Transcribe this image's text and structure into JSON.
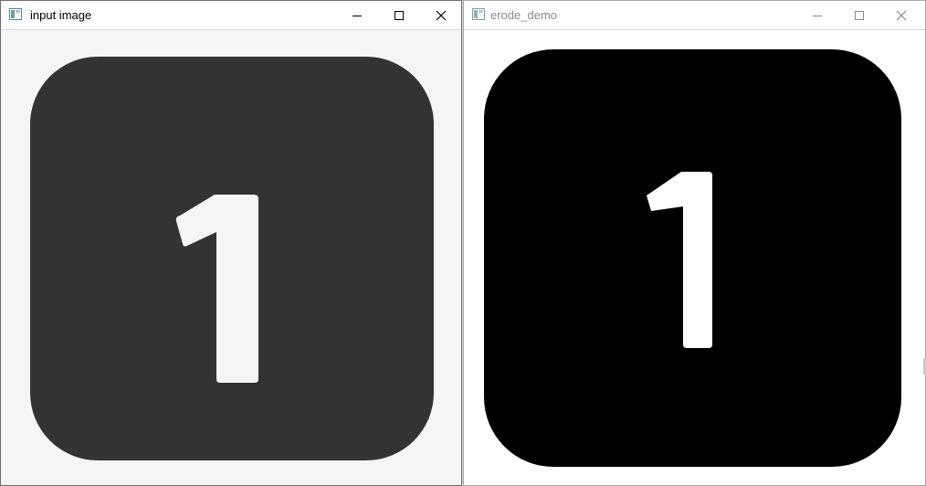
{
  "windows": {
    "input": {
      "title": "input image",
      "background_color": "#f5f5f5",
      "tile_color": "#333333",
      "digit_color": "#f5f5f5",
      "digit": "1"
    },
    "erode": {
      "title": "erode_demo",
      "background_color": "#ffffff",
      "tile_color": "#000000",
      "digit_color": "#ffffff",
      "digit": "1"
    }
  },
  "controls": {
    "minimize_icon": "minimize-icon",
    "maximize_icon": "maximize-icon",
    "close_icon": "close-icon"
  },
  "colors": {
    "active_title_text": "#000000",
    "inactive_title_text": "#8a8a8a"
  }
}
